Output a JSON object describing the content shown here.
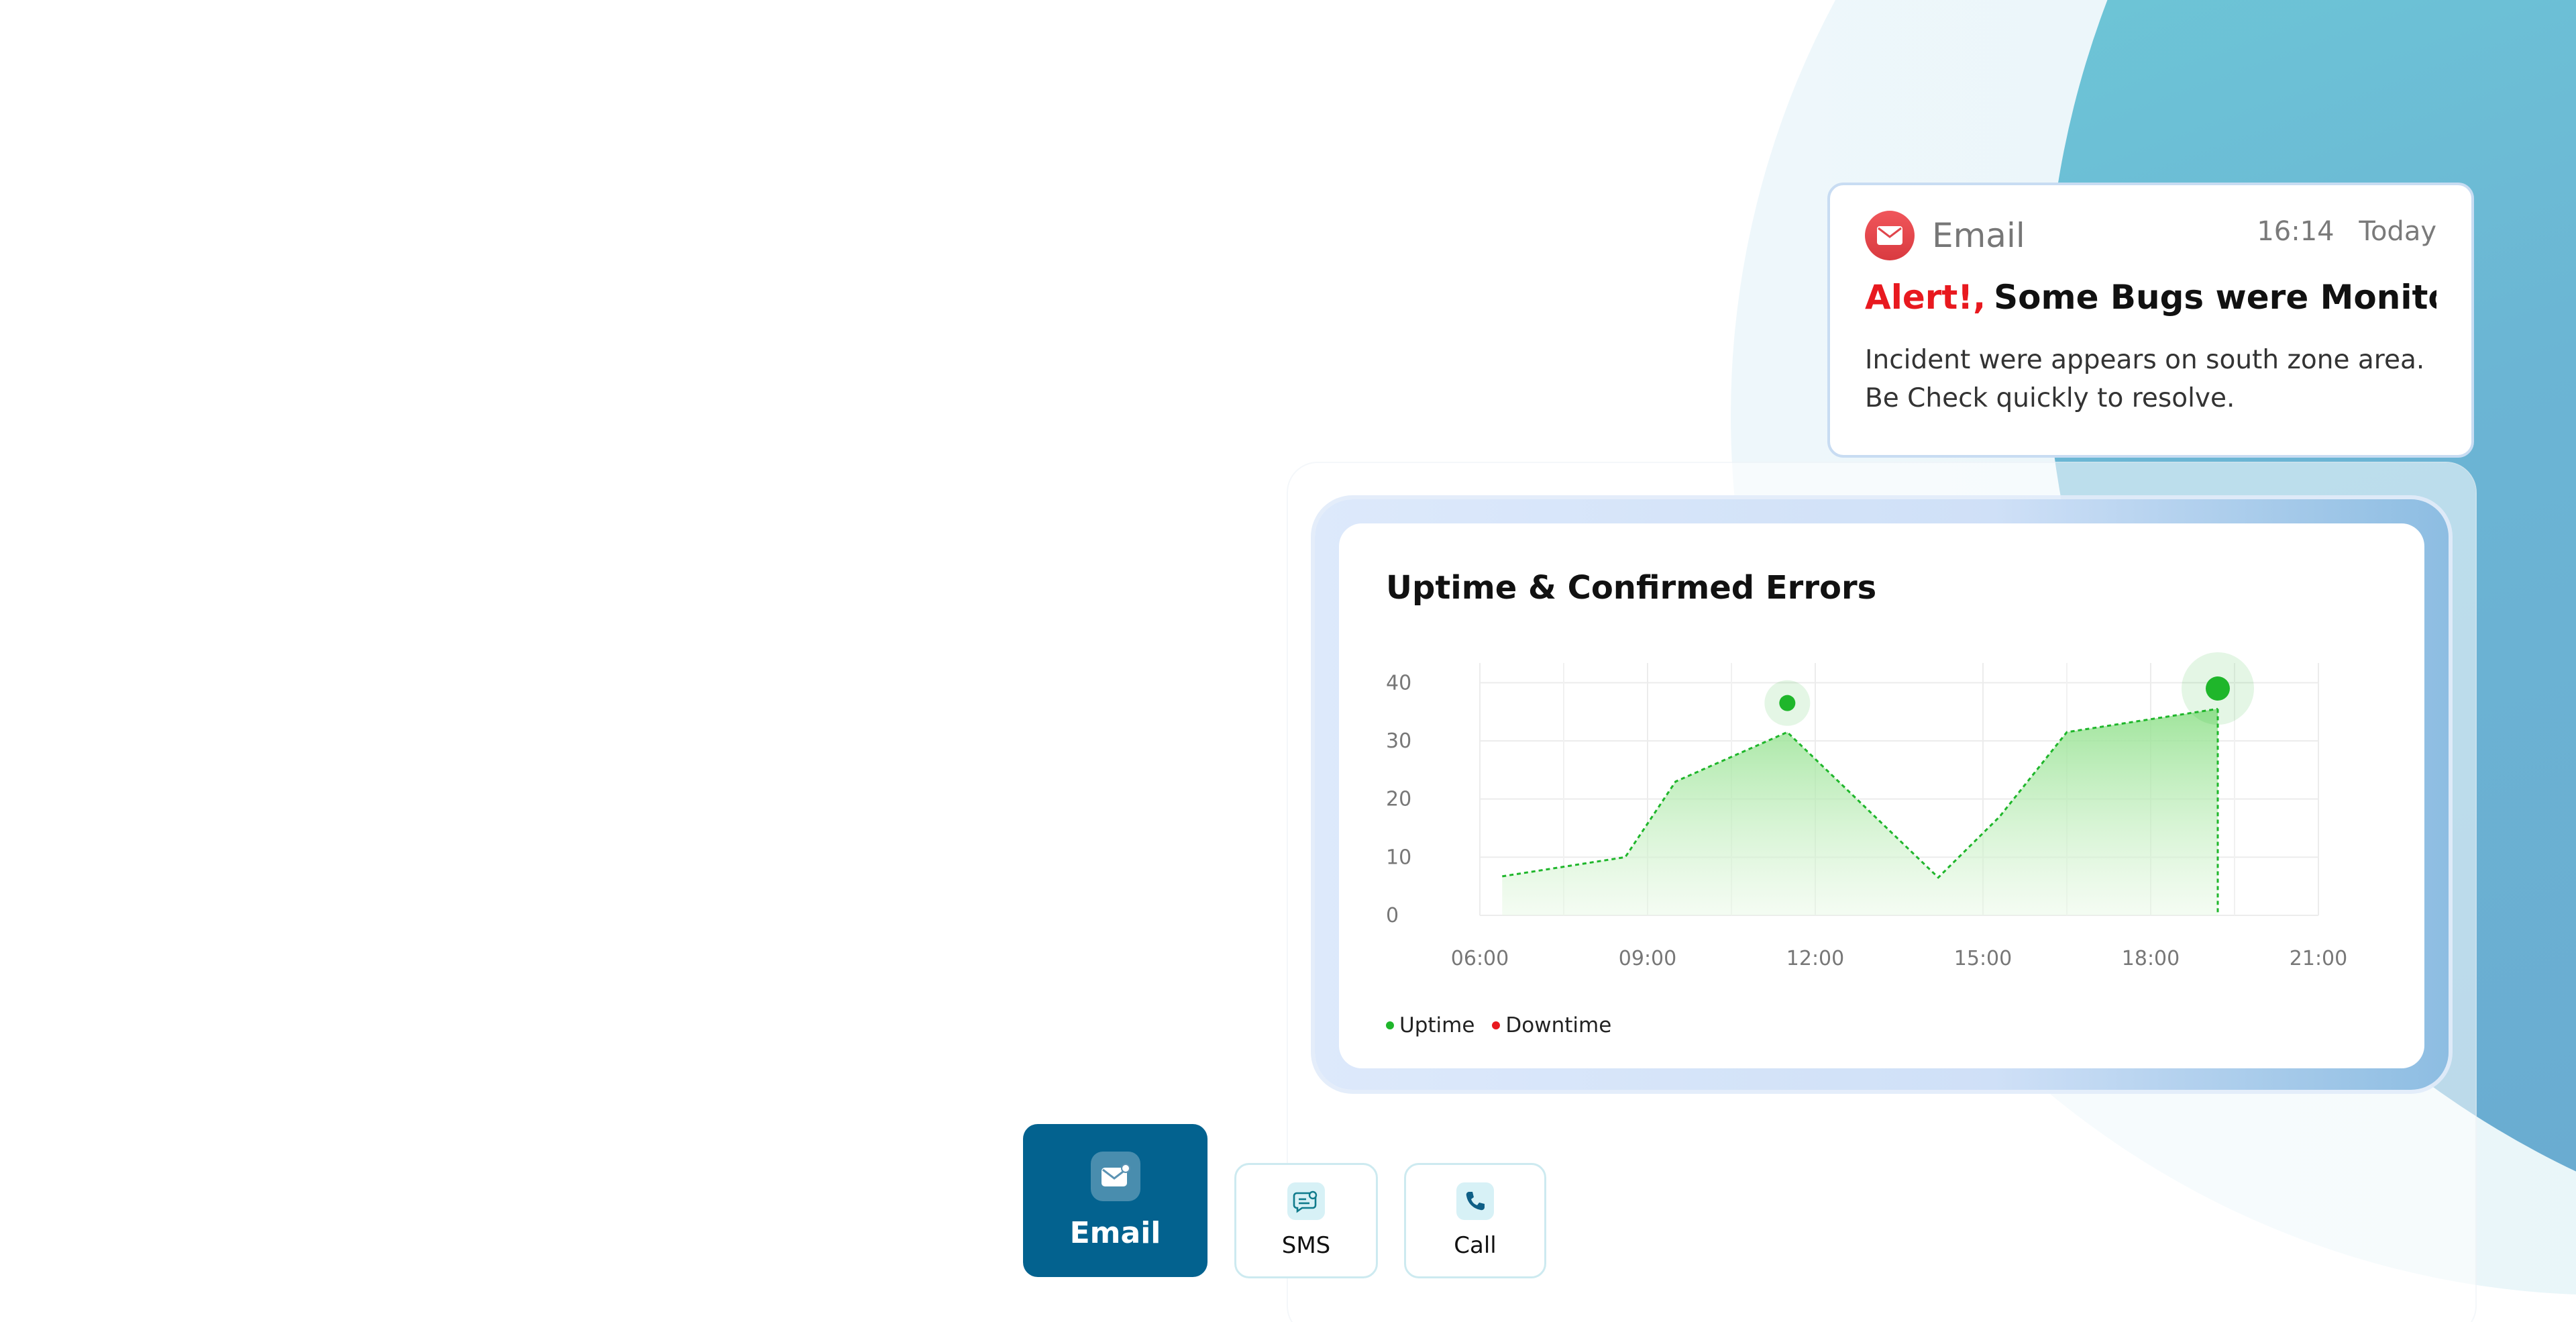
{
  "notification": {
    "app_name": "Email",
    "time": "16:14",
    "day": "Today",
    "alert_prefix": "Alert!,",
    "title": "Some Bugs were Monitored...",
    "message": "Incident were appears on south zone area. Be Check quickly to resolve."
  },
  "chart": {
    "title": "Uptime & Confirmed Errors",
    "legend": [
      {
        "label": "Uptime",
        "color": "#1fb62b"
      },
      {
        "label": "Downtime",
        "color": "#e8191f"
      }
    ]
  },
  "chart_data": {
    "type": "area",
    "title": "Uptime & Confirmed Errors",
    "x_ticks": [
      "06:00",
      "09:00",
      "12:00",
      "15:00",
      "18:00",
      "21:00"
    ],
    "y_ticks": [
      0,
      10,
      20,
      30,
      40
    ],
    "ylim": [
      0,
      42
    ],
    "xlim": [
      6,
      21
    ],
    "grid": true,
    "legend_position": "bottom-left",
    "series": [
      {
        "name": "Uptime",
        "color": "#1fb62b",
        "x": [
          6.4,
          8.6,
          9.5,
          11.5,
          14.2,
          15.3,
          16.5,
          19.2
        ],
        "y": [
          6.7,
          10,
          23,
          31.5,
          6.5,
          17,
          31.5,
          35.5
        ]
      }
    ],
    "annotations": [
      {
        "x": 11.5,
        "y": 36.5,
        "label": ""
      },
      {
        "x": 19.2,
        "y": 39,
        "label": ""
      }
    ]
  },
  "channels": [
    {
      "label": "Email",
      "icon": "mail-icon",
      "active": true
    },
    {
      "label": "SMS",
      "icon": "sms-icon",
      "active": false
    },
    {
      "label": "Call",
      "icon": "phone-icon",
      "active": false
    }
  ],
  "colors": {
    "accent": "#03628f",
    "alert": "#e8191f",
    "uptime": "#1fb62b",
    "teal": "#6fd6d9"
  }
}
